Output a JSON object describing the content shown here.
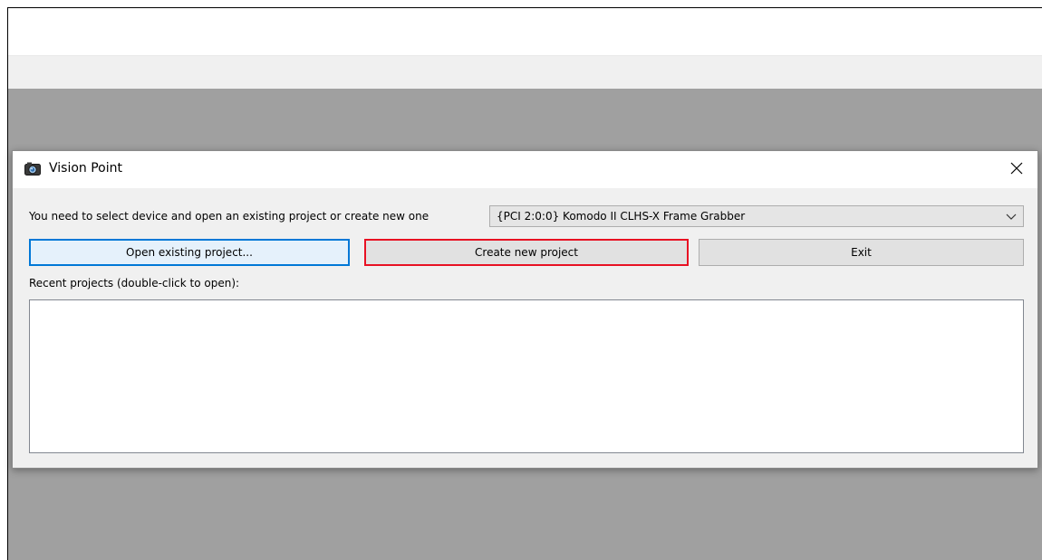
{
  "dialog": {
    "title": "Vision Point",
    "prompt": "You need to select device and open an existing project or create new one",
    "device_select": {
      "value": "{PCI 2:0:0} Komodo II CLHS-X Frame Grabber"
    },
    "buttons": {
      "open_label": "Open existing project...",
      "create_label": "Create new project",
      "exit_label": "Exit"
    },
    "recent_label": "Recent projects (double-click to open):",
    "recent_projects": []
  },
  "icons": {
    "app_icon": "camera-icon",
    "close_icon": "close-icon",
    "dropdown_icon": "chevron-down-icon"
  },
  "colors": {
    "focus_border": "#0078d7",
    "create_border": "#e81123",
    "workspace": "#a0a0a0",
    "dialog_bg": "#f0f0f0"
  }
}
